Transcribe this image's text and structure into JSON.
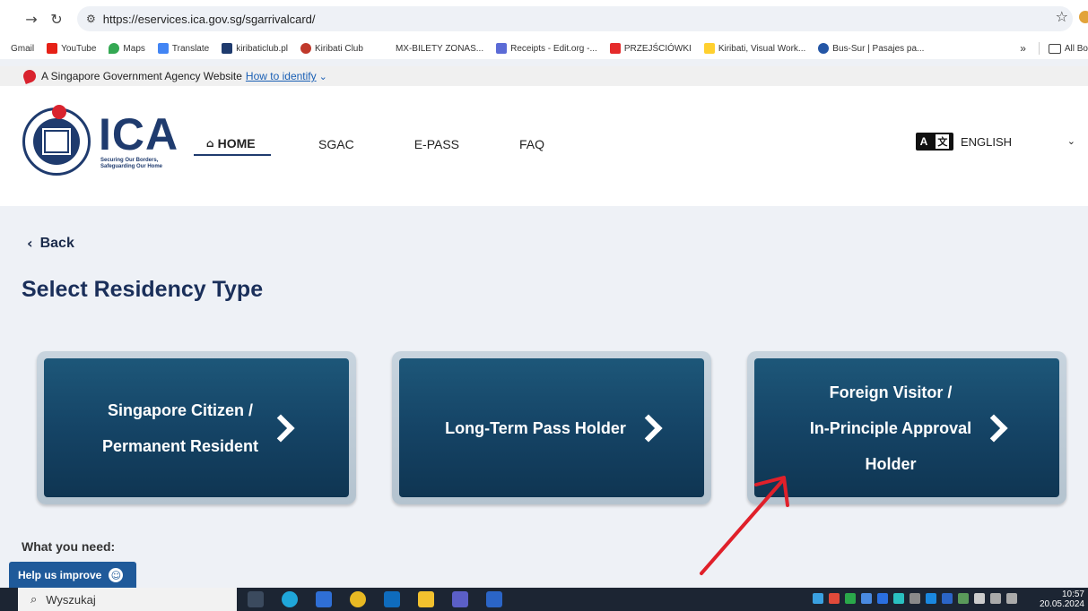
{
  "browser": {
    "url": "https://eservices.ica.gov.sg/sgarrivalcard/",
    "bookmarks": [
      "Gmail",
      "YouTube",
      "Maps",
      "Translate",
      "kiribaticlub.pl",
      "Kiribati Club",
      "MX-BILETY ZONAS...",
      "Receipts - Edit.org -...",
      "PRZEJŚCIÓWKI",
      "Kiribati, Visual Work...",
      "Bus-Sur | Pasajes pa..."
    ],
    "more_bookmarks": "»",
    "all_bookmarks": "All Bo"
  },
  "gov_banner": {
    "text": "A Singapore Government Agency Website",
    "link": "How to identify",
    "link_chevron": "⌄"
  },
  "header": {
    "logo_text": "ICA",
    "logo_tagline": "Securing Our Borders, Safeguarding Our Home",
    "nav": {
      "home": "HOME",
      "sgac": "SGAC",
      "epass": "E-PASS",
      "faq": "FAQ"
    },
    "language": "ENGLISH",
    "lang_icon_a": "A",
    "lang_icon_b": "文"
  },
  "main": {
    "back": "Back",
    "title": "Select Residency Type",
    "cards": {
      "citizen_line1": "Singapore Citizen /",
      "citizen_line2": "Permanent Resident",
      "ltp": "Long-Term Pass Holder",
      "foreign_line1": "Foreign Visitor /",
      "foreign_line2": "In-Principle Approval",
      "foreign_line3": "Holder"
    },
    "what_you_need": "What you need:"
  },
  "help_widget": {
    "label": "Help us improve"
  },
  "taskbar": {
    "search_placeholder": "Wyszukaj",
    "time": "10:57",
    "date": "20.05.2024"
  },
  "colors": {
    "card_blue": "#154466",
    "annotation_red": "#e0202a",
    "brand_navy": "#1f3b6e"
  },
  "icons": [
    "back-arrow-icon",
    "reload-icon",
    "site-settings-icon",
    "star-icon",
    "home-icon",
    "translate-icon",
    "chevron-right-icon",
    "smile-icon",
    "search-icon"
  ]
}
